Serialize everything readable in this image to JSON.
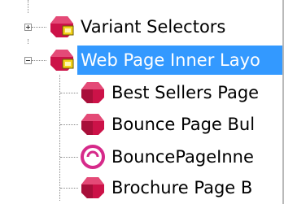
{
  "tree": {
    "items": [
      {
        "label": "Variant Selectors",
        "level": 0,
        "expander": "collapsed",
        "icon": "folder-layout-icon",
        "selected": false
      },
      {
        "label": "Web Page Inner Layo",
        "level": 0,
        "expander": "expanded",
        "icon": "folder-layout-icon",
        "selected": true
      },
      {
        "label": "Best Sellers Page",
        "level": 1,
        "icon": "layout-cube-icon",
        "selected": false
      },
      {
        "label": "Bounce Page Bul",
        "level": 1,
        "icon": "layout-cube-icon",
        "selected": false
      },
      {
        "label": "BouncePageInne",
        "level": 1,
        "icon": "bounce-circle-icon",
        "selected": false
      },
      {
        "label": "Brochure Page B",
        "level": 1,
        "icon": "layout-cube-icon",
        "selected": false
      }
    ]
  },
  "colors": {
    "selection": "#3399ff",
    "cube": "#cc1248",
    "lock": "#f2d21b",
    "circle": "#d62a8a"
  }
}
